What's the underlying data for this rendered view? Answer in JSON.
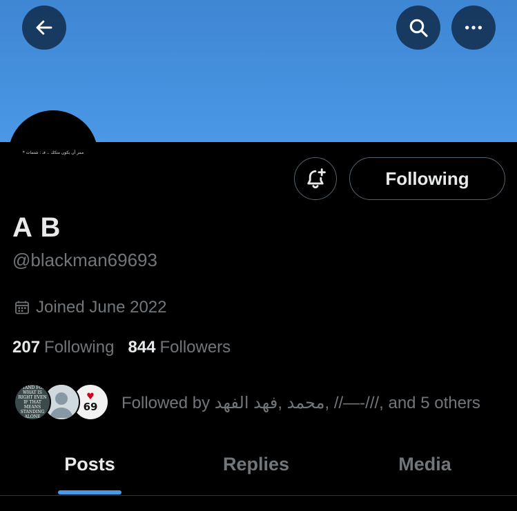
{
  "header": {
    "back_icon": "arrow-left-icon",
    "search_icon": "search-icon",
    "more_icon": "more-horizontal-icon",
    "banner_color": "#4a98e6"
  },
  "profile": {
    "avatar_text": "ممر أن يكون متكك .. فـ : شتماث *",
    "bell_icon": "bell-plus-icon",
    "following_label": "Following",
    "name": "A B",
    "handle": "@blackman69693",
    "joined": "Joined June 2022",
    "following_count": "207",
    "following_label_stat": "Following",
    "followers_count": "844",
    "followers_label_stat": "Followers"
  },
  "followed_by": {
    "avatar1_text": "STAND FOR WHAT IS RIGHT EVEN IF THAT MEANS STANDING ALONE",
    "avatar3_text": "69",
    "text": "Followed by محمد ,فهد الفهد, //—-///, and 5 others"
  },
  "tabs": [
    {
      "label": "Posts",
      "active": true
    },
    {
      "label": "Replies",
      "active": false
    },
    {
      "label": "Media",
      "active": false
    }
  ],
  "colors": {
    "accent": "#4a98e6",
    "muted_text": "#71767b",
    "primary_text": "#e7e9ea"
  }
}
